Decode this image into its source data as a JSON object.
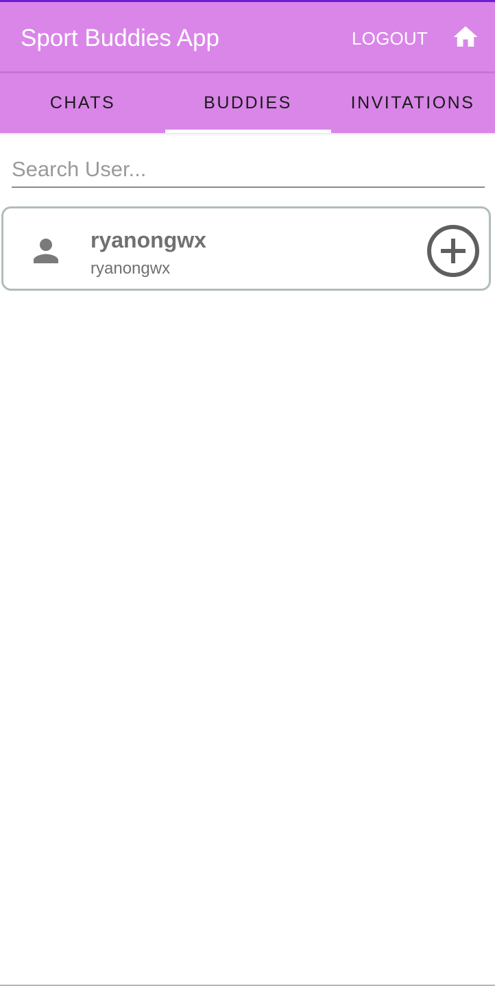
{
  "app_bar": {
    "title": "Sport Buddies App",
    "logout_label": "LOGOUT",
    "home_icon": "home-icon",
    "background_color": "#d986e8",
    "status_accent_color": "#6a1fd1"
  },
  "tabs": {
    "items": [
      {
        "label": "CHATS"
      },
      {
        "label": "BUDDIES"
      },
      {
        "label": "INVITATIONS"
      }
    ],
    "selected": "BUDDIES"
  },
  "search": {
    "placeholder": "Search User...",
    "value": ""
  },
  "users": [
    {
      "display_name": "ryanongwx",
      "username": "ryanongwx",
      "avatar_icon": "person-icon",
      "action_icon": "add-circle-icon"
    }
  ]
}
